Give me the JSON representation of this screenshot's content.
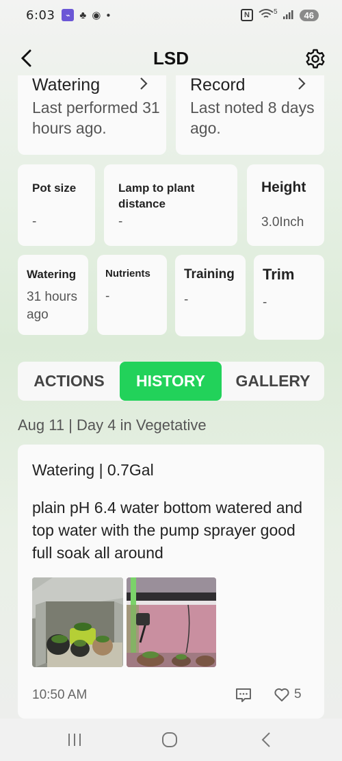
{
  "status_bar": {
    "time": "6:03",
    "battery": "46",
    "network": "5"
  },
  "header": {
    "title": "LSD"
  },
  "top_cards": [
    {
      "title": "Watering",
      "text": "Last performed 31 hours ago."
    },
    {
      "title": "Record",
      "text": "Last noted 8 days ago."
    }
  ],
  "stats_row1": [
    {
      "label": "Pot size",
      "value": "-"
    },
    {
      "label": "Lamp to plant distance",
      "value": "-"
    },
    {
      "label": "Height",
      "value": "3.0Inch"
    }
  ],
  "stats_row2": [
    {
      "label": "Watering",
      "value": "31 hours ago"
    },
    {
      "label": "Nutrients",
      "value": "-"
    },
    {
      "label": "Training",
      "value": "-"
    },
    {
      "label": "Trim",
      "value": "-"
    }
  ],
  "tabs": {
    "actions": "ACTIONS",
    "history": "HISTORY",
    "gallery": "GALLERY",
    "active": "history"
  },
  "history": {
    "date_line": "Aug 11 | Day 4 in Vegetative",
    "entry": {
      "title": "Watering | 0.7Gal",
      "note": "plain pH 6.4 water bottom watered and top water with the pump sprayer good full soak all around",
      "time": "10:50 AM",
      "likes": "5"
    }
  },
  "colors": {
    "accent": "#22d25a",
    "card": "#fafafa"
  }
}
